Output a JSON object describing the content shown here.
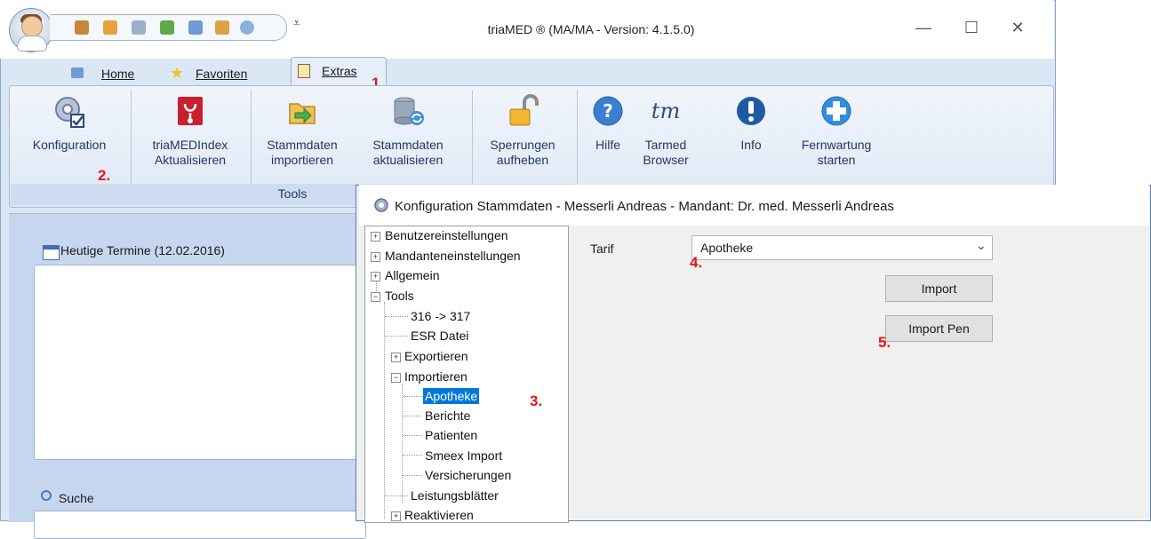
{
  "window": {
    "title": "triaMED ® (MA/MA - Version: 4.1.5.0)",
    "minimize": "—",
    "maximize": "☐",
    "close": "✕"
  },
  "quick_access": {
    "dropdown": "⩡"
  },
  "tabs": {
    "home": "Home",
    "favoriten": "Favoriten",
    "extras": "Extras"
  },
  "ribbon": {
    "buttons": [
      {
        "line1": "Konfiguration",
        "line2": "",
        "icon": "gear-check-icon"
      },
      {
        "line1": "triaMEDIndex",
        "line2": "Aktualisieren",
        "icon": "triamed-index-icon"
      },
      {
        "line1": "Stammdaten",
        "line2": "importieren",
        "icon": "import-folder-icon"
      },
      {
        "line1": "Stammdaten",
        "line2": "aktualisieren",
        "icon": "database-refresh-icon"
      },
      {
        "line1": "Sperrungen",
        "line2": "aufheben",
        "icon": "unlock-icon"
      },
      {
        "line1": "Hilfe",
        "line2": "",
        "icon": "help-icon"
      },
      {
        "line1": "Tarmed",
        "line2": "Browser",
        "icon": "tarmed-icon"
      },
      {
        "line1": "Info",
        "line2": "",
        "icon": "info-icon"
      },
      {
        "line1": "Fernwartung",
        "line2": "starten",
        "icon": "remote-support-icon"
      }
    ],
    "group_label": "Tools"
  },
  "left_panel": {
    "termine_label": "Heutige Termine (12.02.2016)",
    "suche_label": "Suche"
  },
  "dialog": {
    "title": "Konfiguration Stammdaten - Messerli Andreas - Mandant: Dr. med. Messerli Andreas",
    "tree": [
      "Benutzereinstellungen",
      "Mandanteneinstellungen",
      "Allgemein",
      "Tools",
      "316 -> 317",
      "ESR Datei",
      "Exportieren",
      "Importieren",
      "Apotheke",
      "Berichte",
      "Patienten",
      "Smeex Import",
      "Versicherungen",
      "Leistungsblätter",
      "Reaktivieren"
    ],
    "tarif_label": "Tarif",
    "tarif_value": "Apotheke",
    "import_button": "Import",
    "import_pen_button": "Import Pen"
  },
  "steps": [
    "1.",
    "2.",
    "3.",
    "4.",
    "5."
  ],
  "colors": {
    "step_marker": "#e8141c",
    "selection": "#0078d7",
    "ribbon_text": "#1c3a66"
  }
}
